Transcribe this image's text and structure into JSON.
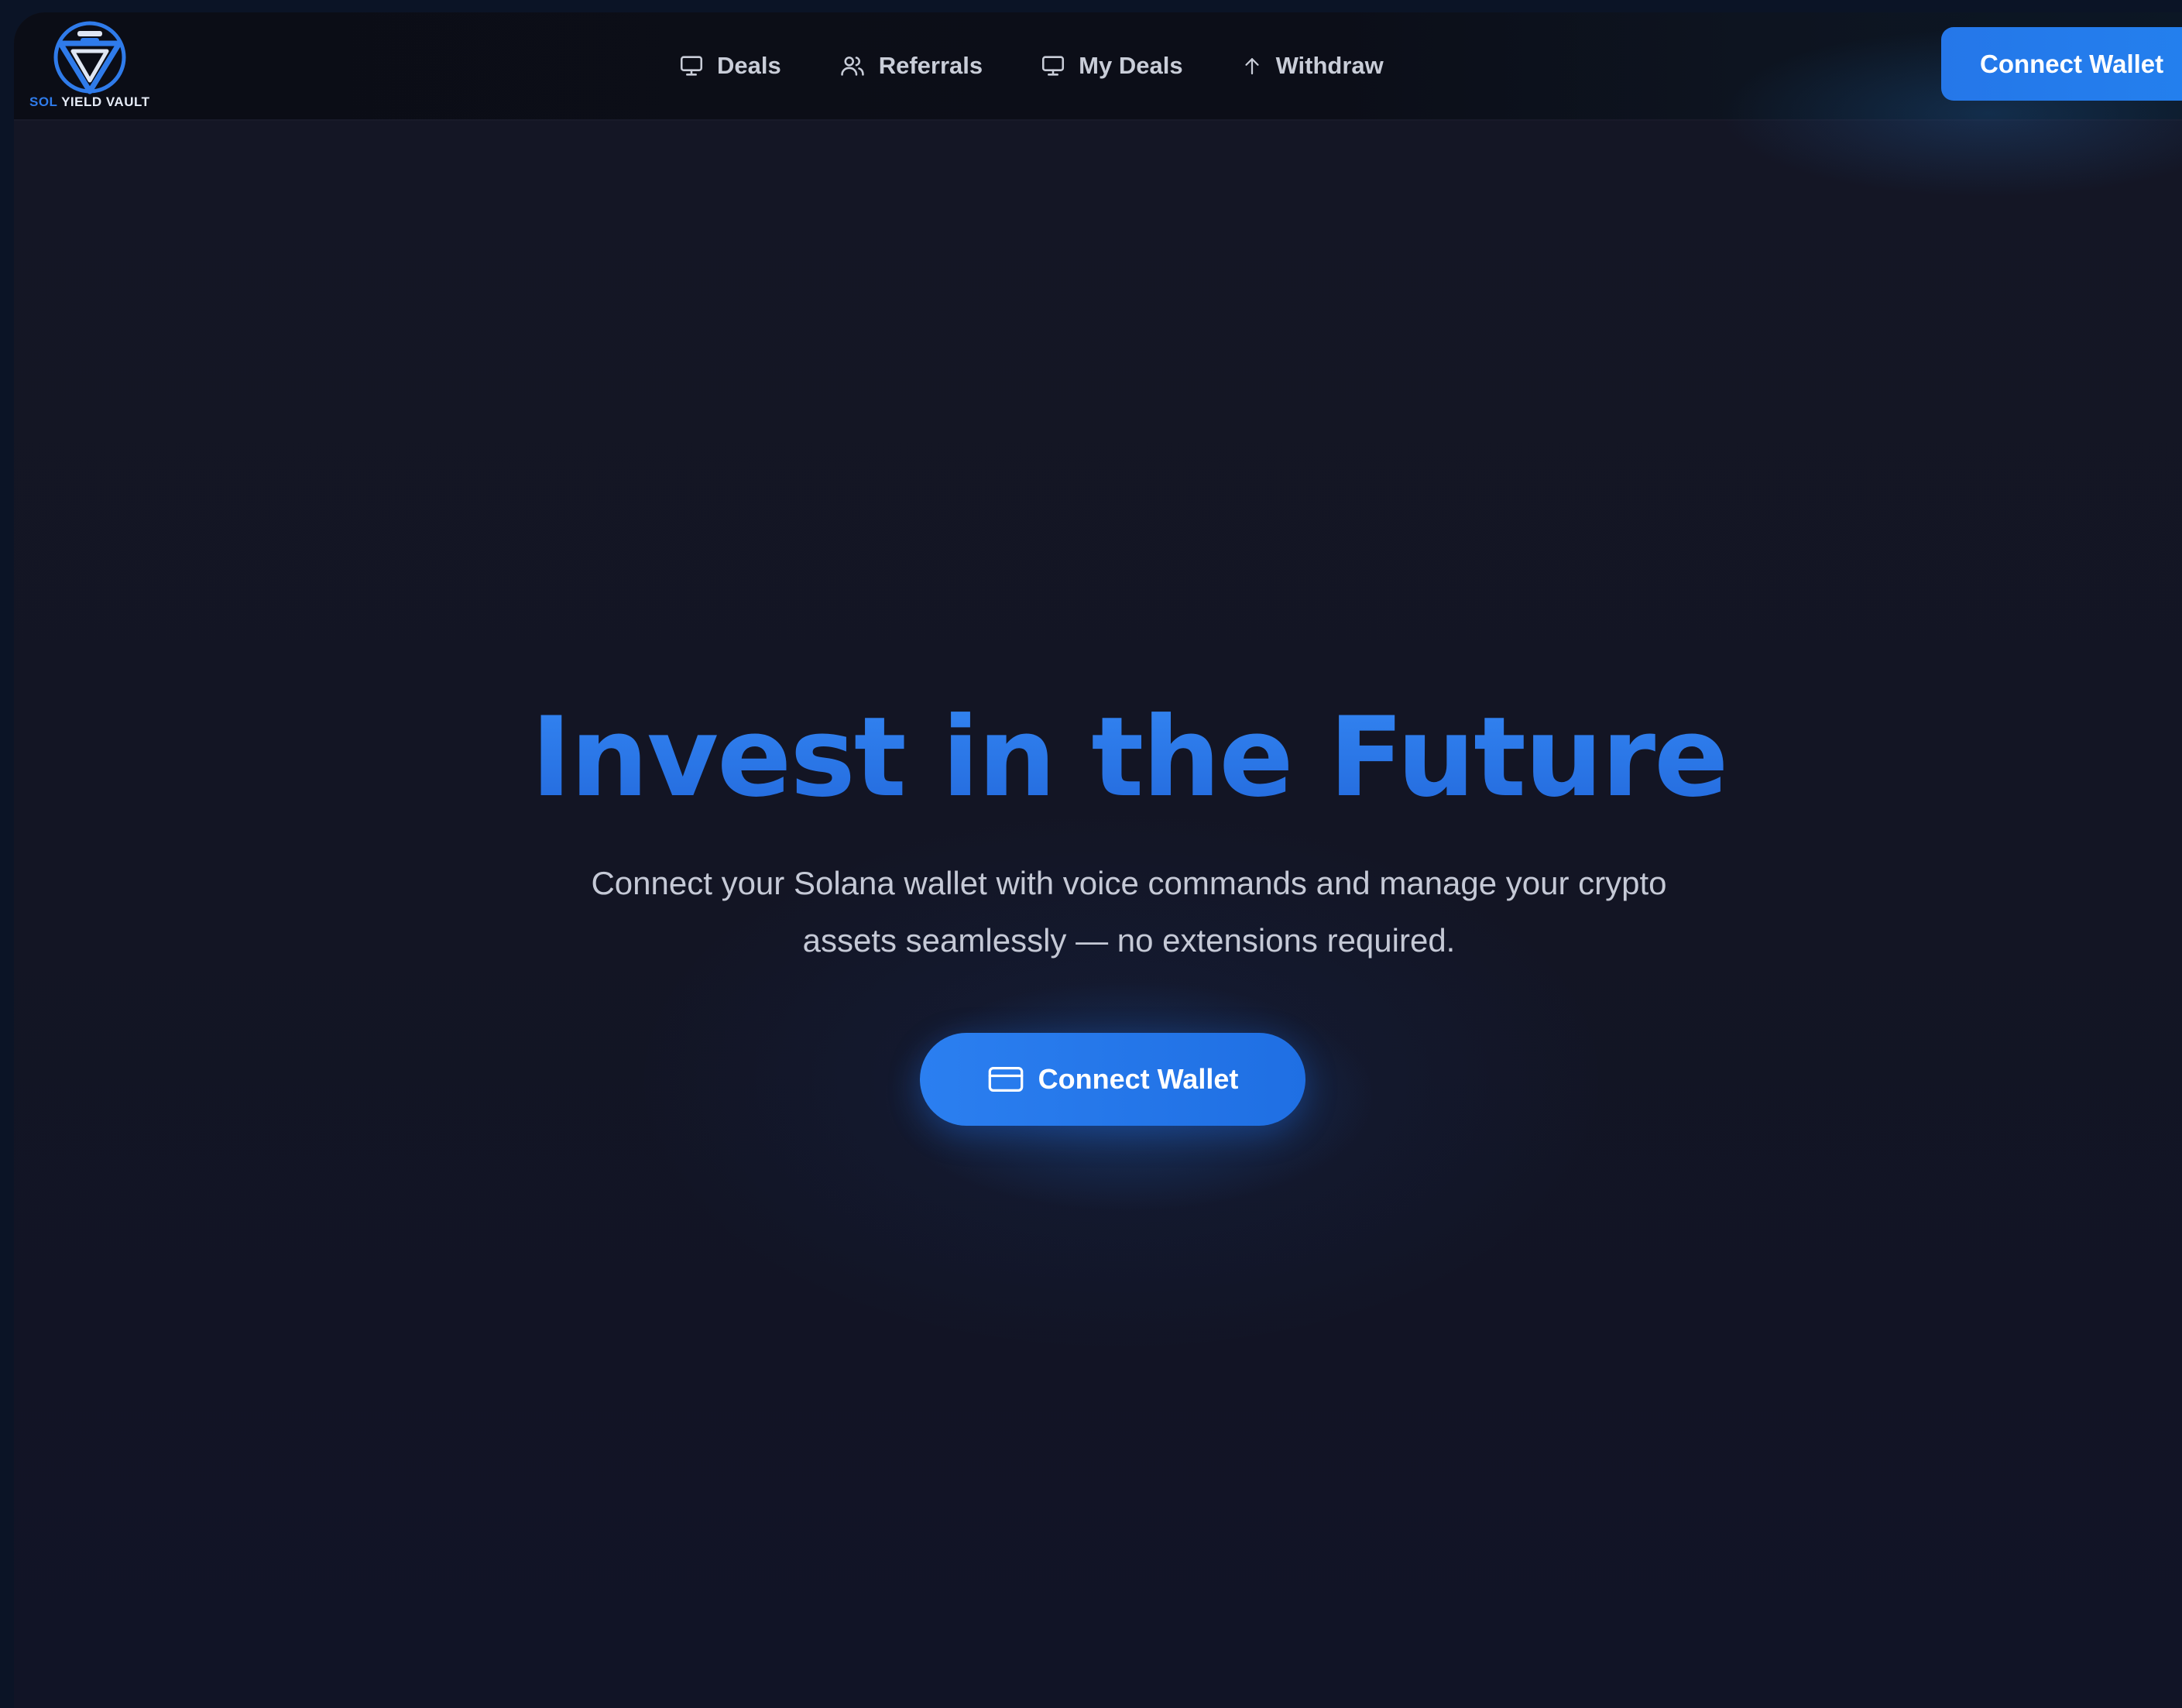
{
  "brand": {
    "logo_text_sol": "SOL",
    "logo_text_rest": "YIELD VAULT"
  },
  "nav": {
    "items": [
      {
        "label": "Deals",
        "icon": "monitor-icon"
      },
      {
        "label": "Referrals",
        "icon": "users-icon"
      },
      {
        "label": "My Deals",
        "icon": "monitor-icon"
      },
      {
        "label": "Withdraw",
        "icon": "arrow-up-icon"
      }
    ],
    "connect_label": "Connect Wallet"
  },
  "hero": {
    "title": "Invest in the Future",
    "subtitle_line1": "Connect your Solana wallet with voice commands and manage your crypto",
    "subtitle_line2": "assets seamlessly — no extensions required.",
    "cta_label": "Connect Wallet",
    "cta_icon": "credit-card-icon"
  },
  "colors": {
    "accent": "#2776ea",
    "background": "#131524",
    "navbar": "#0b0d16",
    "text_muted": "#c5c9d6"
  }
}
